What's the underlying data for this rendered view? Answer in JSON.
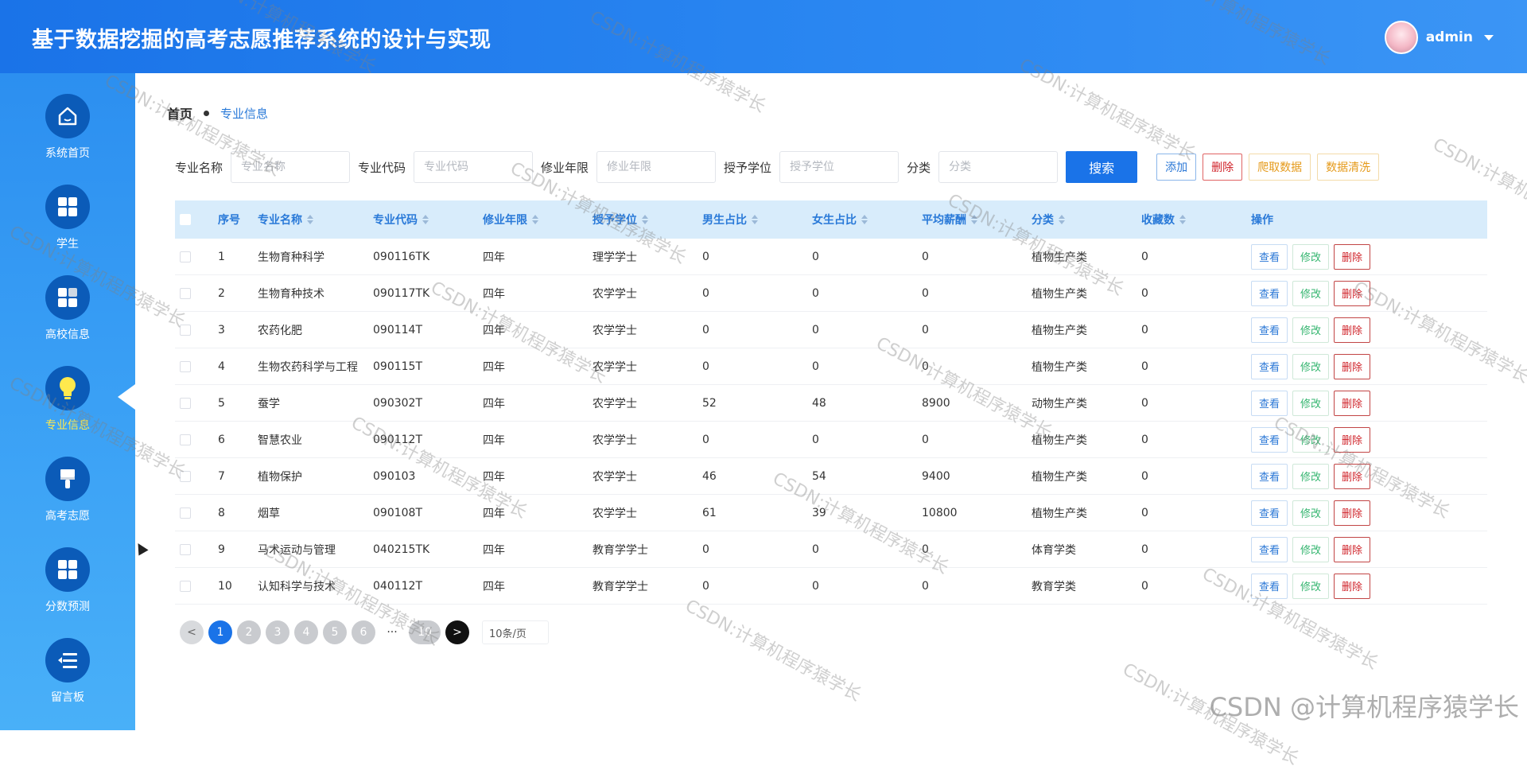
{
  "header": {
    "title": "基于数据挖掘的高考志愿推荐系统的设计与实现",
    "username": "admin"
  },
  "sidebar": {
    "items": [
      {
        "label": "系统首页",
        "icon": "home-icon"
      },
      {
        "label": "学生",
        "icon": "grid-icon"
      },
      {
        "label": "高校信息",
        "icon": "grid-icon"
      },
      {
        "label": "专业信息",
        "icon": "lightbulb-icon",
        "active": true
      },
      {
        "label": "高考志愿",
        "icon": "brush-icon"
      },
      {
        "label": "分数预测",
        "icon": "grid-icon"
      },
      {
        "label": "留言板",
        "icon": "list-icon"
      }
    ]
  },
  "breadcrumb": {
    "home": "首页",
    "current": "专业信息"
  },
  "filters": {
    "name_label": "专业名称",
    "name_placeholder": "专业名称",
    "code_label": "专业代码",
    "code_placeholder": "专业代码",
    "years_label": "修业年限",
    "years_placeholder": "修业年限",
    "degree_label": "授予学位",
    "degree_placeholder": "授予学位",
    "category_label": "分类",
    "category_placeholder": "分类",
    "search_label": "搜索",
    "add_label": "添加",
    "delete_label": "删除",
    "crawl_label": "爬取数据",
    "clean_label": "数据清洗"
  },
  "table": {
    "headers": [
      "序号",
      "专业名称",
      "专业代码",
      "修业年限",
      "授予学位",
      "男生占比",
      "女生占比",
      "平均薪酬",
      "分类",
      "收藏数",
      "操作"
    ],
    "actions": {
      "view": "查看",
      "edit": "修改",
      "delete": "删除"
    },
    "rows": [
      {
        "no": "1",
        "name": "生物育种科学",
        "code": "090116TK",
        "years": "四年",
        "degree": "理学学士",
        "male": "0",
        "female": "0",
        "salary": "0",
        "category": "植物生产类",
        "fav": "0"
      },
      {
        "no": "2",
        "name": "生物育种技术",
        "code": "090117TK",
        "years": "四年",
        "degree": "农学学士",
        "male": "0",
        "female": "0",
        "salary": "0",
        "category": "植物生产类",
        "fav": "0"
      },
      {
        "no": "3",
        "name": "农药化肥",
        "code": "090114T",
        "years": "四年",
        "degree": "农学学士",
        "male": "0",
        "female": "0",
        "salary": "0",
        "category": "植物生产类",
        "fav": "0"
      },
      {
        "no": "4",
        "name": "生物农药科学与工程",
        "code": "090115T",
        "years": "四年",
        "degree": "农学学士",
        "male": "0",
        "female": "0",
        "salary": "0",
        "category": "植物生产类",
        "fav": "0"
      },
      {
        "no": "5",
        "name": "蚕学",
        "code": "090302T",
        "years": "四年",
        "degree": "农学学士",
        "male": "52",
        "female": "48",
        "salary": "8900",
        "category": "动物生产类",
        "fav": "0"
      },
      {
        "no": "6",
        "name": "智慧农业",
        "code": "090112T",
        "years": "四年",
        "degree": "农学学士",
        "male": "0",
        "female": "0",
        "salary": "0",
        "category": "植物生产类",
        "fav": "0"
      },
      {
        "no": "7",
        "name": "植物保护",
        "code": "090103",
        "years": "四年",
        "degree": "农学学士",
        "male": "46",
        "female": "54",
        "salary": "9400",
        "category": "植物生产类",
        "fav": "0"
      },
      {
        "no": "8",
        "name": "烟草",
        "code": "090108T",
        "years": "四年",
        "degree": "农学学士",
        "male": "61",
        "female": "39",
        "salary": "10800",
        "category": "植物生产类",
        "fav": "0"
      },
      {
        "no": "9",
        "name": "马术运动与管理",
        "code": "040215TK",
        "years": "四年",
        "degree": "教育学学士",
        "male": "0",
        "female": "0",
        "salary": "0",
        "category": "体育学类",
        "fav": "0"
      },
      {
        "no": "10",
        "name": "认知科学与技术",
        "code": "040112T",
        "years": "四年",
        "degree": "教育学学士",
        "male": "0",
        "female": "0",
        "salary": "0",
        "category": "教育学类",
        "fav": "0"
      }
    ]
  },
  "pagination": {
    "prev": "<",
    "pages": [
      "1",
      "2",
      "3",
      "4",
      "5",
      "6"
    ],
    "ellipsis": "···",
    "last": "10",
    "next": ">",
    "page_size": "10条/页",
    "current": 1
  },
  "watermark": {
    "text": "CSDN:计算机程序猿学长",
    "corner": "CSDN @计算机程序猿学长"
  },
  "colors": {
    "primary": "#1a73e8",
    "active_nav": "#ffe94d",
    "danger": "#d0242b",
    "success": "#34b56f",
    "warning": "#e59a1a"
  }
}
